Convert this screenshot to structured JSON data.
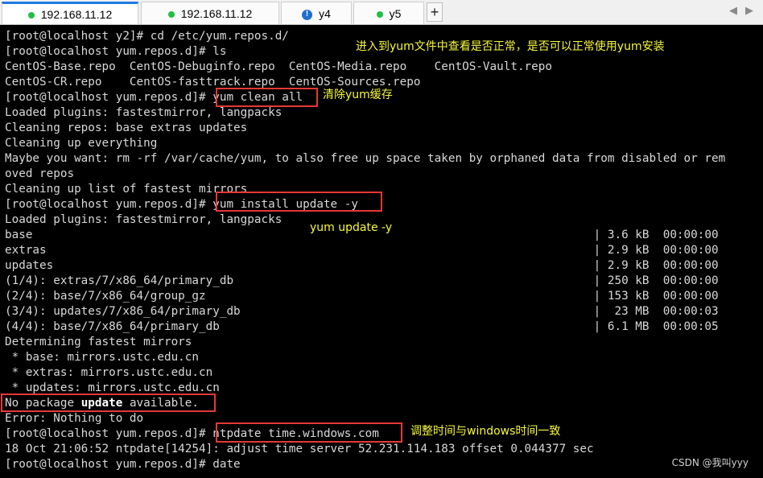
{
  "tabs": [
    {
      "label": "192.168.11.12",
      "icon": "green-dot-icon",
      "active": true
    },
    {
      "label": "192.168.11.12",
      "icon": "green-dot-icon",
      "active": false
    },
    {
      "label": "y4",
      "icon": "warning-icon",
      "active": false
    },
    {
      "label": "y5",
      "icon": "green-dot-icon",
      "active": false
    }
  ],
  "tabbar": {
    "add_label": "+",
    "prev_label": "◀",
    "next_label": "▶"
  },
  "terminal": {
    "lines": [
      "[root@localhost y2]# cd /etc/yum.repos.d/",
      "[root@localhost yum.repos.d]# ls",
      "CentOS-Base.repo  CentOS-Debuginfo.repo  CentOS-Media.repo    CentOS-Vault.repo",
      "CentOS-CR.repo    CentOS-fasttrack.repo  CentOS-Sources.repo",
      "[root@localhost yum.repos.d]# yum clean all",
      "Loaded plugins: fastestmirror, langpacks",
      "Cleaning repos: base extras updates",
      "Cleaning up everything",
      "Maybe you want: rm -rf /var/cache/yum, to also free up space taken by orphaned data from disabled or rem",
      "oved repos",
      "Cleaning up list of fastest mirrors",
      "[root@localhost yum.repos.d]# yum install update -y",
      "Loaded plugins: fastestmirror, langpacks",
      "base                                                                                 | 3.6 kB  00:00:00",
      "extras                                                                               | 2.9 kB  00:00:00",
      "updates                                                                              | 2.9 kB  00:00:00",
      "(1/4): extras/7/x86_64/primary_db                                                    | 250 kB  00:00:00",
      "(2/4): base/7/x86_64/group_gz                                                        | 153 kB  00:00:00",
      "(3/4): updates/7/x86_64/primary_db                                                   |  23 MB  00:00:03",
      "(4/4): base/7/x86_64/primary_db                                                      | 6.1 MB  00:00:05",
      "Determining fastest mirrors",
      " * base: mirrors.ustc.edu.cn",
      " * extras: mirrors.ustc.edu.cn",
      " * updates: mirrors.ustc.edu.cn",
      "No package update available.",
      "Error: Nothing to do",
      "[root@localhost yum.repos.d]# ntpdate time.windows.com",
      "18 Oct 21:06:52 ntpdate[14254]: adjust time server 52.231.114.183 offset 0.044377 sec",
      "[root@localhost yum.repos.d]# date"
    ],
    "no_package_prefix": "No package ",
    "no_package_bold": "update",
    "no_package_suffix": " available."
  },
  "annotations": {
    "note_check_repo": "进入到yum文件中查看是否正常，是否可以正常使用yum安装",
    "note_clean_cache": "清除yum缓存",
    "note_install": "yum update -y",
    "note_ntpdate": "调整时间与windows时间一致"
  },
  "watermark": "CSDN @我叫yyy",
  "colors": {
    "highlight_box": "#e53935",
    "annotation_text": "#f7f73a",
    "active_tab_accent": "#1f7ae0"
  }
}
